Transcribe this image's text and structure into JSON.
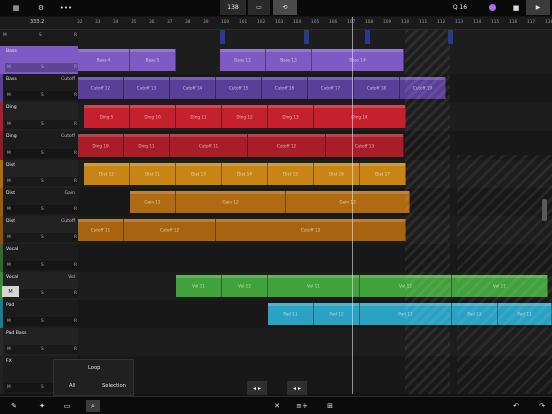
{
  "toolbar": {
    "tempo": "138",
    "quantize": "Q 16",
    "mixer_icon": "mixer-icon",
    "settings_icon": "settings-gear-icon",
    "more_label": "•••",
    "pattern_label": "▭",
    "loop_label": "⟲",
    "play_label": "▶",
    "stop_label": "■",
    "record_color": "#b06df0"
  },
  "ruler": {
    "position": "333.2",
    "ticks": [
      "32",
      "33",
      "34",
      "35",
      "36",
      "37",
      "38",
      "39",
      "100",
      "101",
      "102",
      "103",
      "104",
      "105",
      "106",
      "107",
      "108",
      "109",
      "110",
      "111",
      "112",
      "113",
      "114",
      "115",
      "116",
      "117",
      "118"
    ]
  },
  "upsell": {
    "line1": "Unlimited tracks with In-App Purchase",
    "line2": "4 tracks out of the box"
  },
  "tracks": [
    {
      "name": "Bass",
      "param": "",
      "color": "#7e5bc4",
      "selected": true
    },
    {
      "name": "Bass",
      "param": "Cutoff",
      "color": "#5a3f98"
    },
    {
      "name": "Ding",
      "param": "",
      "color": "#a8202b"
    },
    {
      "name": "Ding",
      "param": "Cutoff",
      "color": "#8e1c25"
    },
    {
      "name": "Dist",
      "param": "",
      "color": "#b06a12"
    },
    {
      "name": "Dist",
      "param": "Gain",
      "color": "#9a5c10"
    },
    {
      "name": "Dist",
      "param": "Cutoff",
      "color": "#8d540e"
    },
    {
      "name": "Vocal",
      "param": "",
      "color": "#2f6a2f"
    },
    {
      "name": "Vocal",
      "param": "Vol",
      "color": "#3d8a37"
    },
    {
      "name": "Pad",
      "param": "",
      "color": "#1f7a93"
    },
    {
      "name": "Pad Bass",
      "param": "",
      "color": "#2a2a2a"
    },
    {
      "name": "FX",
      "param": "",
      "color": "#222"
    }
  ],
  "mini_controls": {
    "m": "M",
    "s": "S",
    "r": "R"
  },
  "vocal_mute_button": "M",
  "clips": {
    "bass": [
      "Bass 4",
      "Bass 5",
      "Bass 12",
      "Bass 13",
      "Bass 14"
    ],
    "bass_cutoff": [
      "Cutoff 12",
      "Cutoff 13",
      "Cutoff 14",
      "Cutoff 15",
      "Cutoff 16",
      "Cutoff 17",
      "Cutoff 18",
      "Cutoff 19"
    ],
    "ding": [
      "Ding 5",
      "Ding 10",
      "Ding 11",
      "Ding 12",
      "Ding 13",
      "Ding 14"
    ],
    "ding_cutoff": [
      "Ding 19",
      "Ding 11",
      "Cutoff 11",
      "Cutoff 12",
      "Cutoff 13"
    ],
    "dist": [
      "Dist 12",
      "Dist 11",
      "Dist 13",
      "Dist 14",
      "Dist 15",
      "Dist 16",
      "Dist 17"
    ],
    "dist_gain": [
      "Gain 11",
      "Gain 12",
      "Gain 13"
    ],
    "dist_cutoff": [
      "Cutoff 11",
      "Cutoff 12",
      "Cutoff 13"
    ],
    "vocal_vol": [
      "Vol 11",
      "Vol 12",
      "Vol 11",
      "Vol 12",
      "Vol 11"
    ],
    "pad": [
      "Pad 11",
      "Pad 12",
      "Pad 11",
      "Pad 12",
      "Pad 11"
    ]
  },
  "popover": {
    "loop": "Loop",
    "all": "All",
    "selection": "Selection"
  },
  "nav_arrows": {
    "left": "◂ ▸",
    "right": "◂ ▸"
  },
  "bottombar": {
    "pencil": "✎",
    "wand": "✦",
    "view": "▭",
    "zoom": "⌕",
    "delete": "✕",
    "add": "≡+",
    "split": "⊞",
    "undo": "↶",
    "redo": "↷"
  }
}
